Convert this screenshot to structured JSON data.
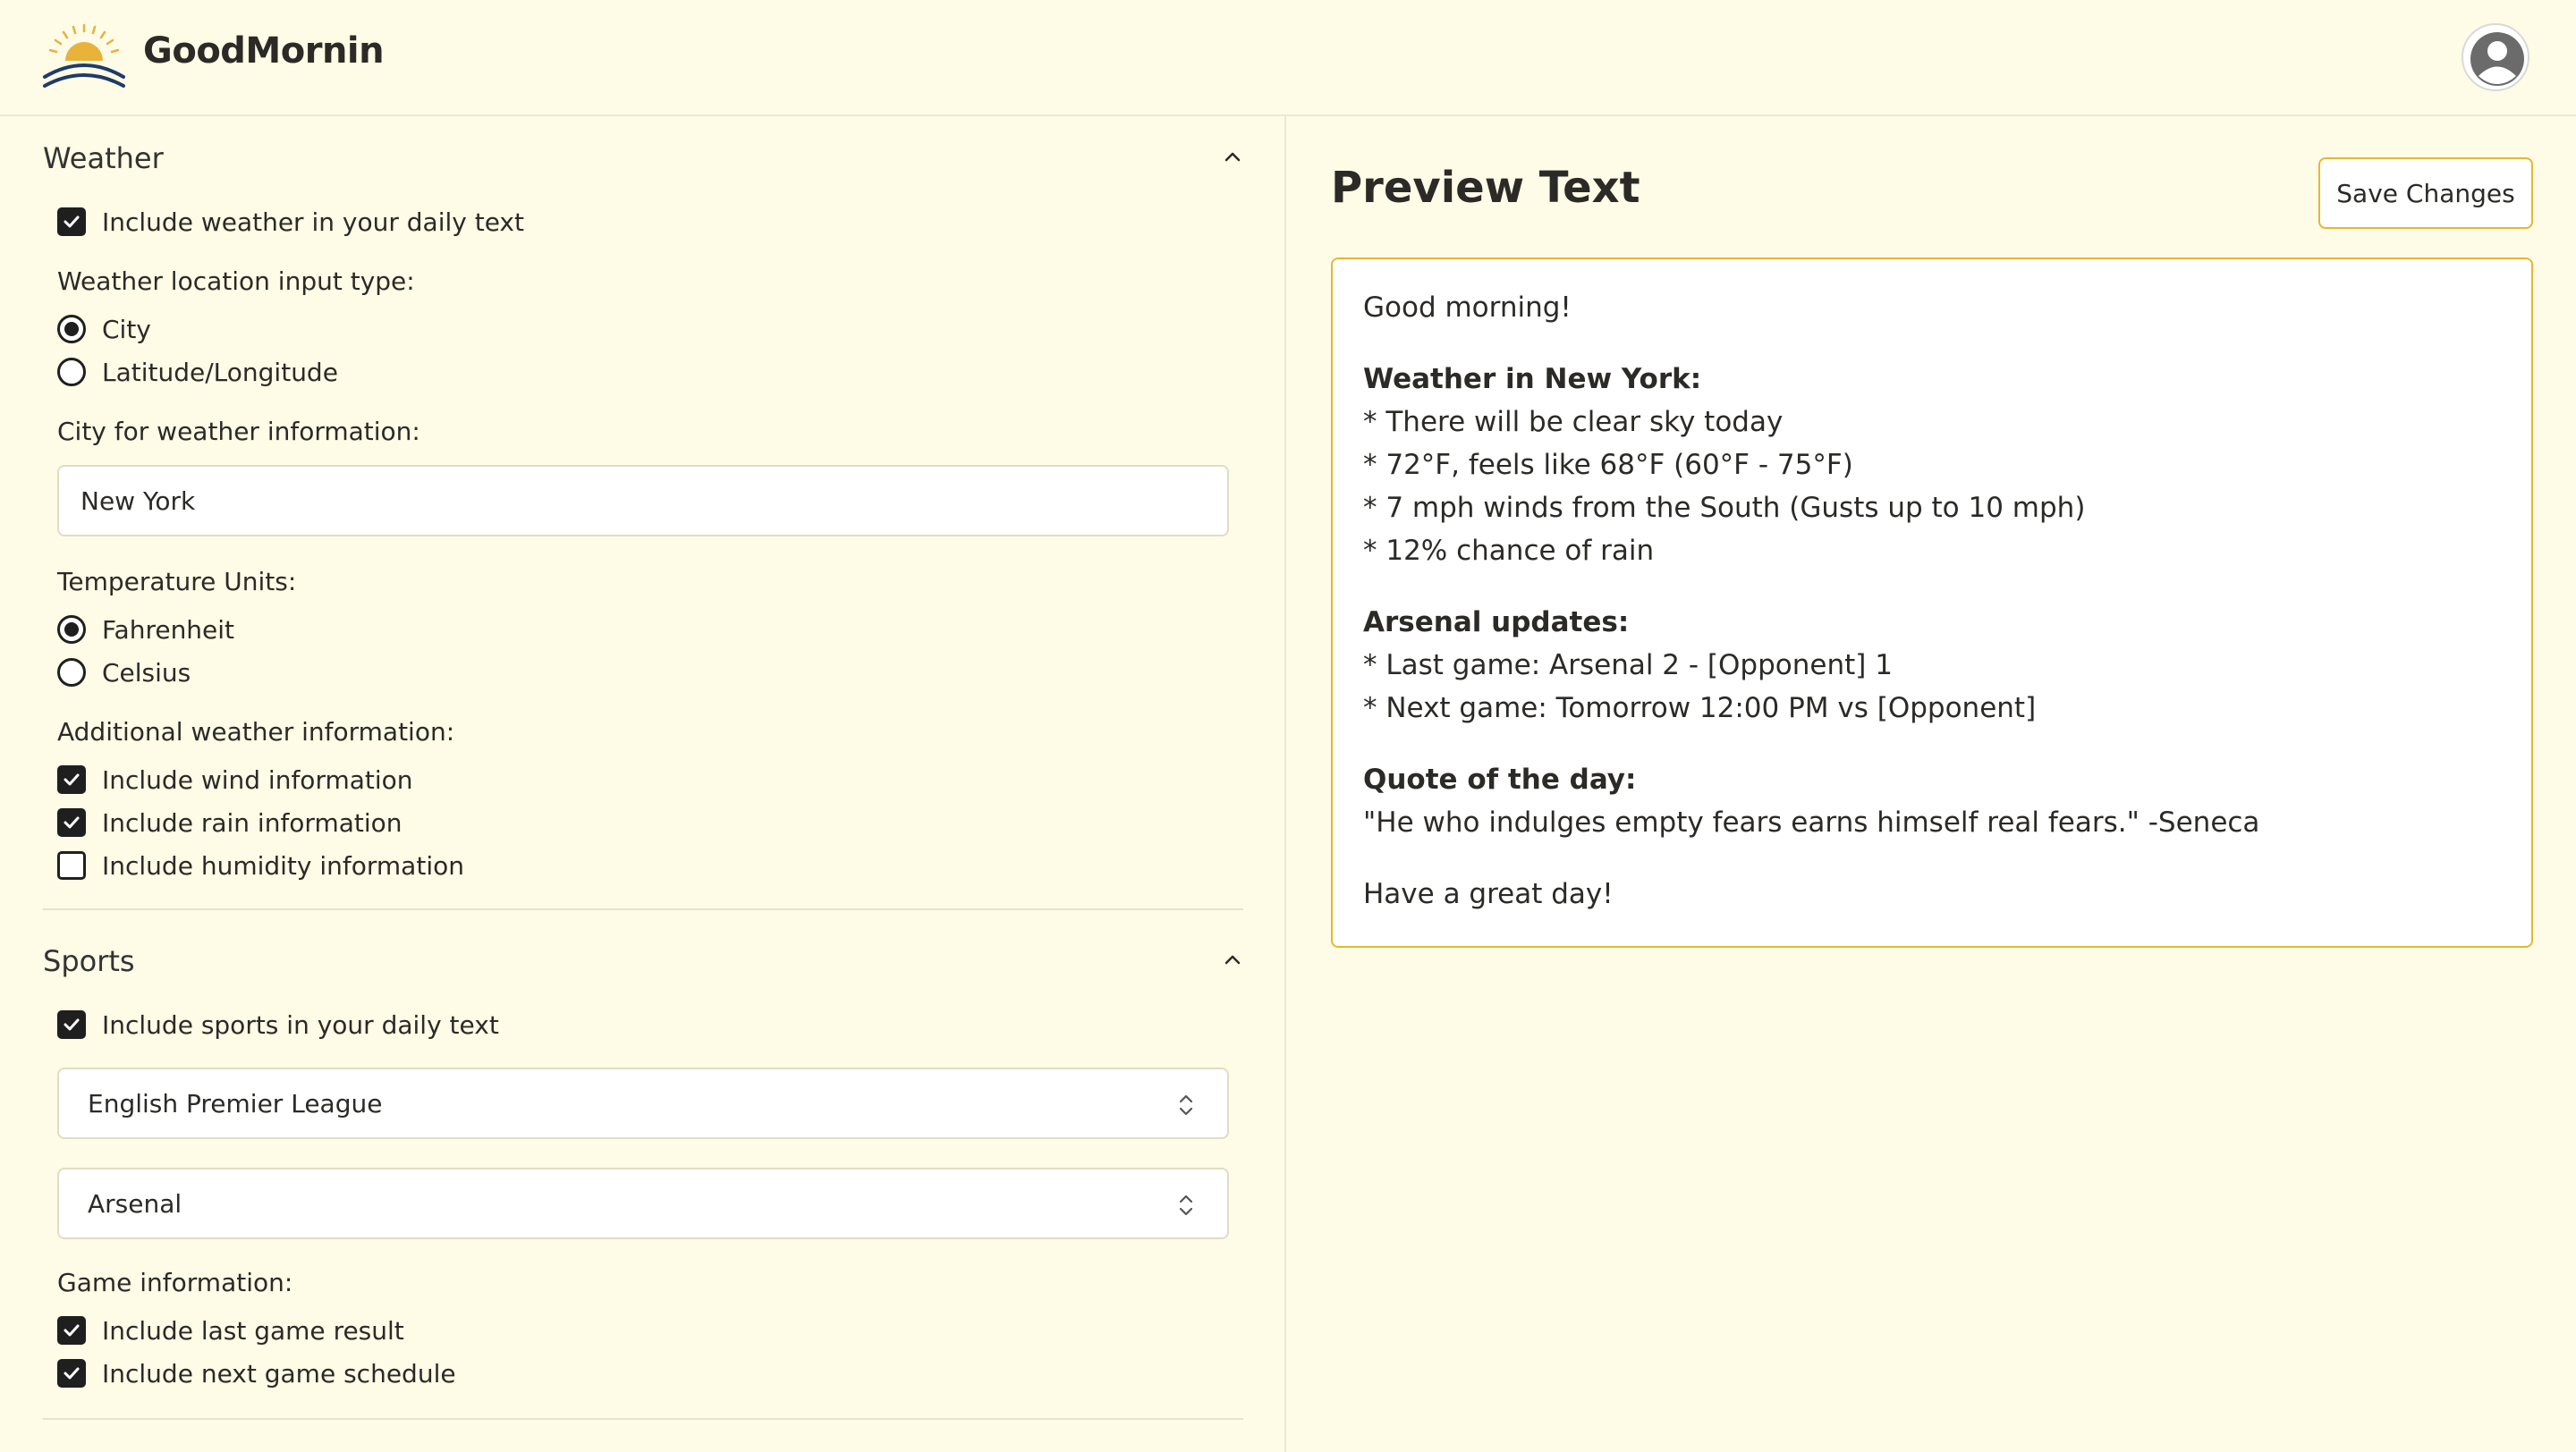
{
  "app": {
    "name": "GoodMornin"
  },
  "icons": {
    "logo": "sunrise-logo-icon",
    "avatar": "user-avatar-icon",
    "chevron": "chevron-up-icon",
    "select": "up-down-chevron-icon"
  },
  "colors": {
    "background": "#fefbe6",
    "accent": "#e5b732",
    "sun": "#e9b23b",
    "wave": "#1f3b66"
  },
  "weather": {
    "title": "Weather",
    "include_label": "Include weather in your daily text",
    "include_checked": true,
    "location_type_label": "Weather location input type:",
    "location_types": [
      {
        "label": "City",
        "selected": true
      },
      {
        "label": "Latitude/Longitude",
        "selected": false
      }
    ],
    "city_label": "City for weather information:",
    "city_value": "New York",
    "units_label": "Temperature Units:",
    "units": [
      {
        "label": "Fahrenheit",
        "selected": true
      },
      {
        "label": "Celsius",
        "selected": false
      }
    ],
    "additional_label": "Additional weather information:",
    "additional": [
      {
        "label": "Include wind information",
        "checked": true
      },
      {
        "label": "Include rain information",
        "checked": true
      },
      {
        "label": "Include humidity information",
        "checked": false
      }
    ]
  },
  "sports": {
    "title": "Sports",
    "include_label": "Include sports in your daily text",
    "include_checked": true,
    "league": "English Premier League",
    "team": "Arsenal",
    "game_info_label": "Game information:",
    "game_info": [
      {
        "label": "Include last game result",
        "checked": true
      },
      {
        "label": "Include next game schedule",
        "checked": true
      }
    ]
  },
  "preview": {
    "title": "Preview Text",
    "save_label": "Save Changes",
    "greeting": "Good morning!",
    "weather_heading": "Weather in New York:",
    "weather_lines": [
      "* There will be clear sky today",
      "* 72°F, feels like 68°F (60°F - 75°F)",
      "* 7 mph winds from the South (Gusts up to 10 mph)",
      "* 12% chance of rain"
    ],
    "sports_heading": "Arsenal updates:",
    "sports_lines": [
      "* Last game: Arsenal 2 - [Opponent] 1",
      "* Next game: Tomorrow 12:00 PM vs [Opponent]"
    ],
    "quote_heading": "Quote of the day:",
    "quote": "\"He who indulges empty fears earns himself real fears.\" -Seneca",
    "closing": "Have a great day!"
  }
}
